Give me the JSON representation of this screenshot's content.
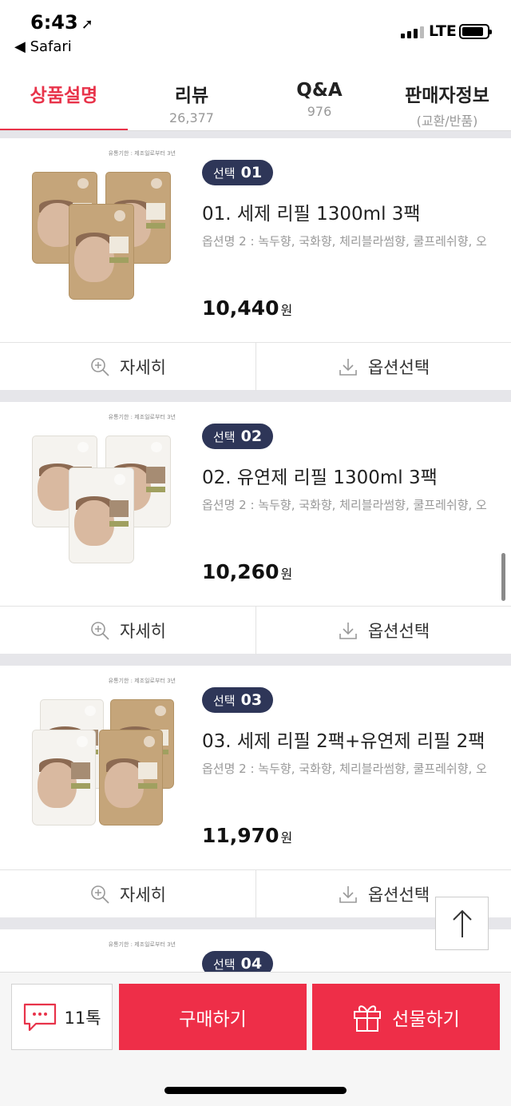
{
  "status_bar": {
    "time": "6:43",
    "back_app": "◀ Safari",
    "network": "LTE"
  },
  "tabs": [
    {
      "label": "상품설명",
      "sub": ""
    },
    {
      "label": "리뷰",
      "sub": "26,377"
    },
    {
      "label": "Q&A",
      "sub": "976"
    },
    {
      "label": "판매자정보",
      "sub": "(교환/반품)"
    }
  ],
  "products": [
    {
      "badge_label": "선택",
      "badge_num": "01",
      "name": "01. 세제 리필 1300ml 3팩",
      "options": "옵션명 2 : 녹두향, 국화향, 체리블라썸향, 쿨프레쉬향, 오",
      "price": "10,440",
      "currency": "원",
      "image_note": "유통기한 : 제조일로부터 3년"
    },
    {
      "badge_label": "선택",
      "badge_num": "02",
      "name": "02. 유연제 리필 1300ml 3팩",
      "options": "옵션명 2 : 녹두향, 국화향, 체리블라썸향, 쿨프레쉬향, 오",
      "price": "10,260",
      "currency": "원",
      "image_note": "유통기한 : 제조일로부터 3년"
    },
    {
      "badge_label": "선택",
      "badge_num": "03",
      "name": "03. 세제 리필 2팩+유연제 리필 2팩",
      "options": "옵션명 2 : 녹두향, 국화향, 체리블라썸향, 쿨프레쉬향, 오",
      "price": "11,970",
      "currency": "원",
      "image_note": "유통기한 : 제조일로부터 3년"
    },
    {
      "badge_label": "선택",
      "badge_num": "04",
      "name": "",
      "options": "",
      "price": "",
      "currency": "",
      "image_note": "유통기한 : 제조일로부터 3년"
    }
  ],
  "card_actions": {
    "detail_label": "자세히",
    "option_label": "옵션선택"
  },
  "bottom_bar": {
    "talk_count": "11톡",
    "buy_label": "구매하기",
    "gift_label": "선물하기"
  },
  "colors": {
    "accent": "#ee2e48",
    "badge": "#2e3658",
    "tab_active": "#e8334a"
  },
  "icons": [
    "location-arrow-icon",
    "signal-icon",
    "battery-icon",
    "zoom-plus-icon",
    "download-icon",
    "arrow-up-icon",
    "chat-bubble-icon",
    "gift-icon"
  ]
}
